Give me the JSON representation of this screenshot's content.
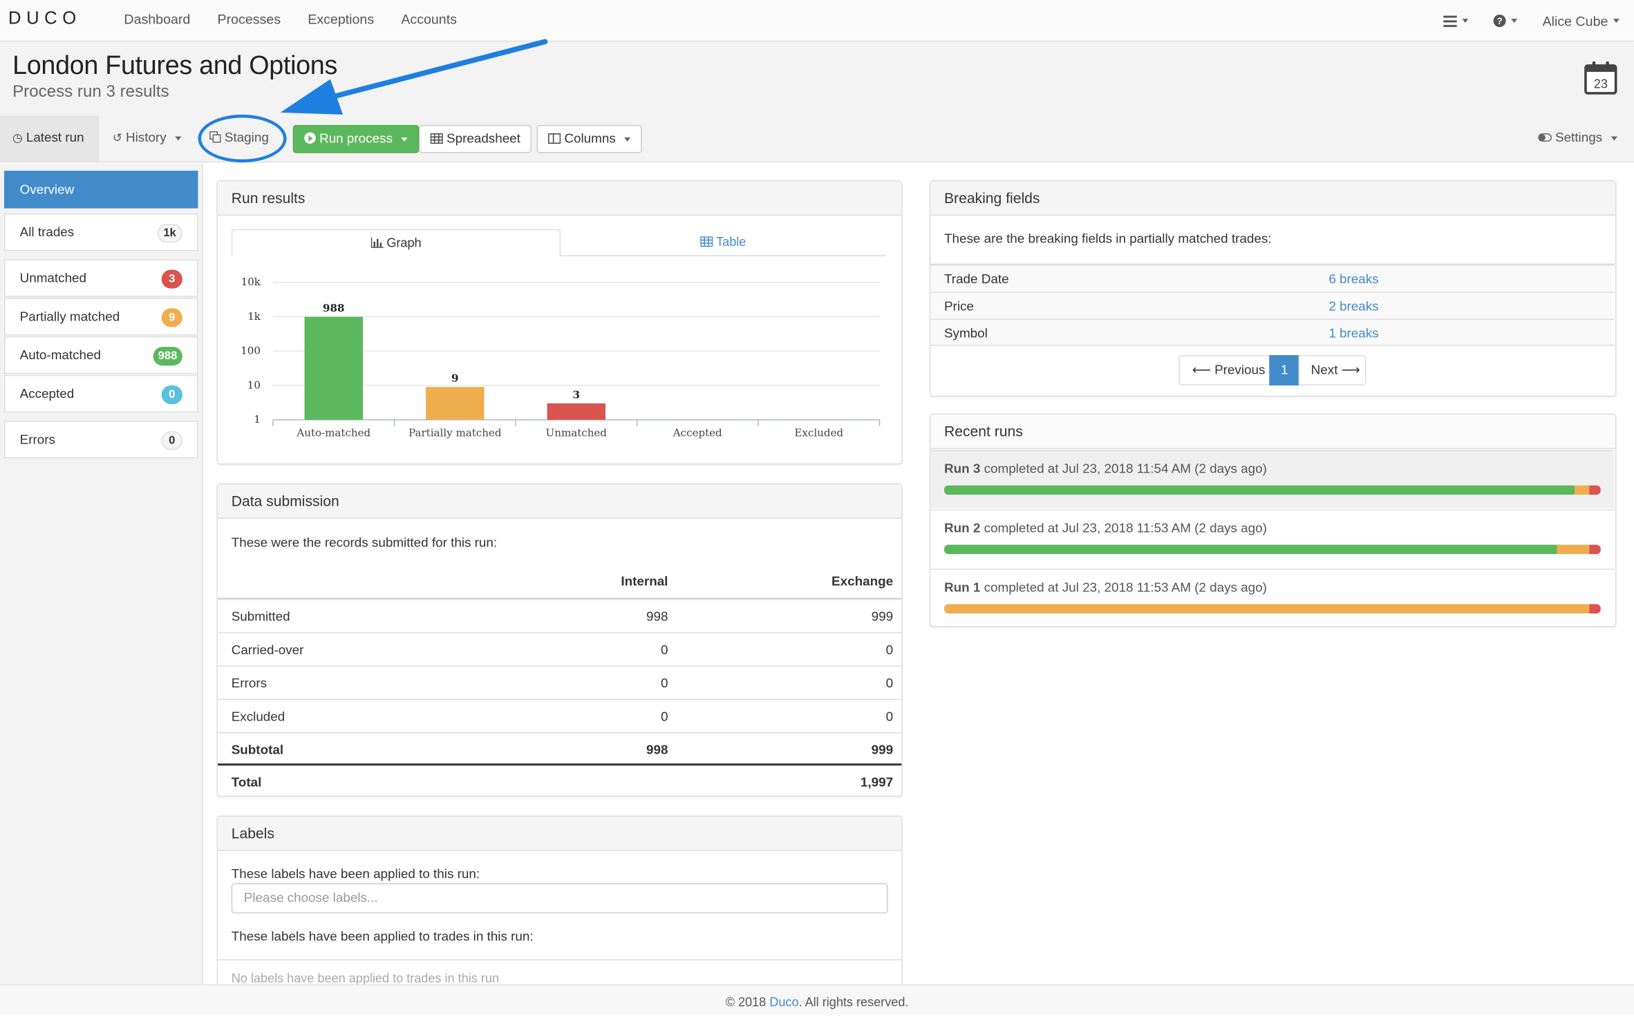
{
  "navbar": {
    "logo": "DUCO",
    "links": [
      "Dashboard",
      "Processes",
      "Exceptions",
      "Accounts"
    ],
    "user": "Alice Cube",
    "menu_icon": "hamburger-icon",
    "help_icon": "question-circle-icon"
  },
  "header": {
    "title": "London Futures and Options",
    "subtitle": "Process run 3 results",
    "calendar_day": "23"
  },
  "toolbar": {
    "latest_run": "Latest run",
    "history": "History",
    "staging": "Staging",
    "run_process": "Run process",
    "spreadsheet": "Spreadsheet",
    "columns": "Columns",
    "settings": "Settings"
  },
  "sidebar": {
    "overview": "Overview",
    "items": [
      {
        "label": "All trades",
        "badge": "1k"
      },
      {
        "label": "Unmatched",
        "badge": "3"
      },
      {
        "label": "Partially matched",
        "badge": "9"
      },
      {
        "label": "Auto-matched",
        "badge": "988"
      },
      {
        "label": "Accepted",
        "badge": "0"
      },
      {
        "label": "Errors",
        "badge": "0"
      }
    ]
  },
  "run_results": {
    "title": "Run results",
    "tab_graph": "Graph",
    "tab_table": "Table"
  },
  "chart_data": {
    "type": "bar",
    "categories": [
      "Auto-matched",
      "Partially matched",
      "Unmatched",
      "Accepted",
      "Excluded"
    ],
    "values": [
      988,
      9,
      3,
      0,
      0
    ],
    "data_labels": [
      "988",
      "9",
      "3",
      "",
      ""
    ],
    "colors": [
      "#5cb85c",
      "#f0ad4e",
      "#d9534f",
      "#999999",
      "#999999"
    ],
    "yscale": "log",
    "yticks": [
      "10k",
      "1k",
      "100",
      "10",
      "1"
    ],
    "ylim": [
      1,
      10000
    ],
    "grid": true,
    "title": "",
    "xlabel": "",
    "ylabel": ""
  },
  "data_submission": {
    "title": "Data submission",
    "intro": "These were the records submitted for this run:",
    "headers": [
      "",
      "Internal",
      "Exchange"
    ],
    "rows": [
      [
        "Submitted",
        "998",
        "999"
      ],
      [
        "Carried-over",
        "0",
        "0"
      ],
      [
        "Errors",
        "0",
        "0"
      ],
      [
        "Excluded",
        "0",
        "0"
      ]
    ],
    "subtotal": [
      "Subtotal",
      "998",
      "999"
    ],
    "total": [
      "Total",
      "1,997"
    ]
  },
  "labels": {
    "title": "Labels",
    "run_text": "These labels have been applied to this run:",
    "placeholder": "Please choose labels...",
    "trades_text": "These labels have been applied to trades in this run:",
    "none_text": "No labels have been applied to trades in this run"
  },
  "breaking_fields": {
    "title": "Breaking fields",
    "intro": "These are the breaking fields in partially matched trades:",
    "rows": [
      {
        "field": "Trade Date",
        "breaks": "6 breaks"
      },
      {
        "field": "Price",
        "breaks": "2 breaks"
      },
      {
        "field": "Symbol",
        "breaks": "1 breaks"
      }
    ],
    "pager": {
      "previous": "Previous",
      "page": "1",
      "next": "Next"
    }
  },
  "recent_runs": {
    "title": "Recent runs",
    "runs": [
      {
        "name": "Run 3",
        "text": "completed at Jul 23, 2018 11:54 AM (2 days ago)",
        "auto_matched_fraction": 0.961,
        "partial_fraction": 0.021,
        "unmatched_fraction": 0.018
      },
      {
        "name": "Run 2",
        "text": "completed at Jul 23, 2018 11:53 AM (2 days ago)",
        "auto_matched_fraction": 0.933,
        "partial_fraction": 0.049,
        "unmatched_fraction": 0.018
      },
      {
        "name": "Run 1",
        "text": "completed at Jul 23, 2018 11:53 AM (2 days ago)",
        "auto_matched_fraction": 0.0,
        "partial_fraction": 0.982,
        "unmatched_fraction": 0.018
      }
    ]
  },
  "footer": {
    "prefix": "© 2018 ",
    "link": "Duco",
    "suffix": ". All rights reserved."
  },
  "colors": {
    "primary": "#428bca",
    "success": "#5cb85c",
    "warning": "#f0ad4e",
    "danger": "#d9534f",
    "info": "#5bc0de",
    "annotation": "#1f7fe0"
  }
}
